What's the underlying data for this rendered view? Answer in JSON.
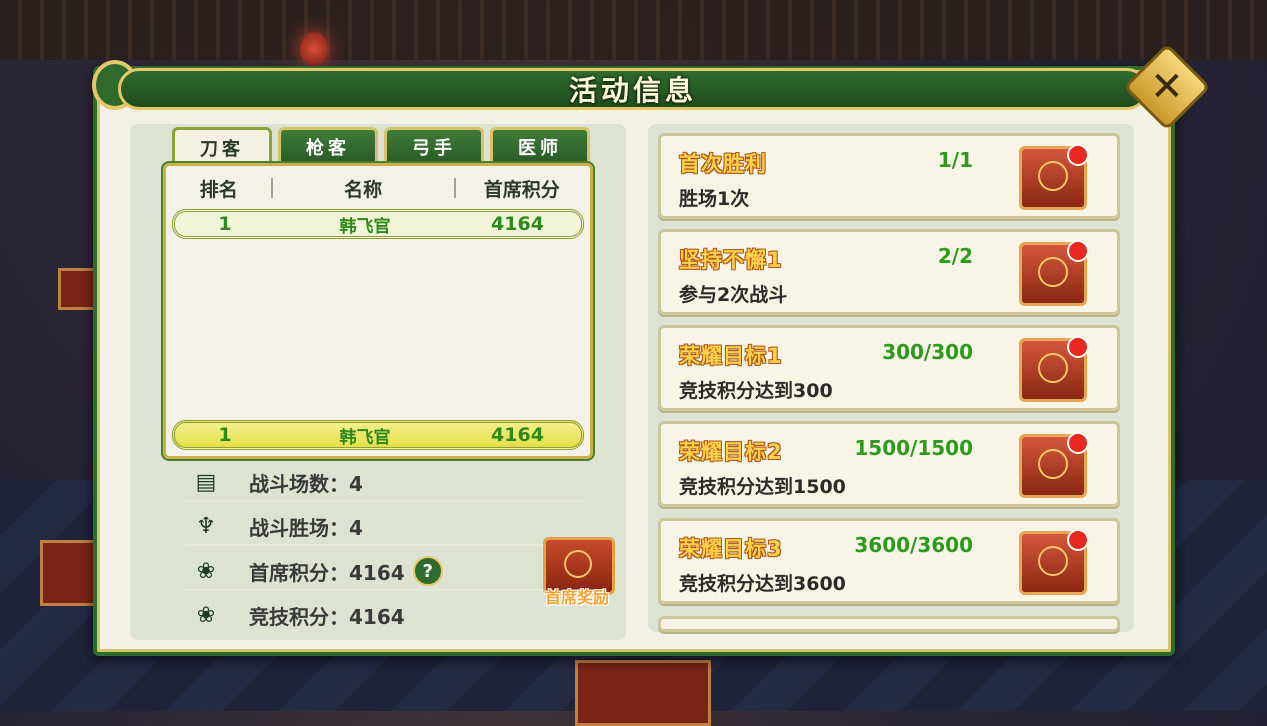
{
  "title": "活动信息",
  "tabs": [
    "刀客",
    "枪客",
    "弓手",
    "医师"
  ],
  "rank_table": {
    "headers": {
      "rank": "排名",
      "name": "名称",
      "score": "首席积分"
    },
    "top_row": {
      "rank": "1",
      "name": "韩飞官",
      "score": "4164"
    },
    "my_row": {
      "rank": "1",
      "name": "韩飞官",
      "score": "4164"
    }
  },
  "stats": [
    {
      "icon": "document-icon",
      "text": "战斗场数：4"
    },
    {
      "icon": "crown-icon",
      "text": "战斗胜场：4"
    },
    {
      "icon": "lotus-icon",
      "text": "首席积分：4164"
    },
    {
      "icon": "lotus-icon",
      "text": "竞技积分：4164"
    }
  ],
  "help_icon": "?",
  "reward": {
    "label": "首席奖励"
  },
  "tasks": [
    {
      "title": "首次胜利",
      "progress": "1/1",
      "desc": "胜场1次"
    },
    {
      "title": "坚持不懈1",
      "progress": "2/2",
      "desc": "参与2次战斗"
    },
    {
      "title": "荣耀目标1",
      "progress": "300/300",
      "desc": "竞技积分达到300"
    },
    {
      "title": "荣耀目标2",
      "progress": "1500/1500",
      "desc": "竞技积分达到1500"
    },
    {
      "title": "荣耀目标3",
      "progress": "3600/3600",
      "desc": "竞技积分达到3600"
    }
  ],
  "colors": {
    "frame_green": "#2f6b2c",
    "gold": "#e3c86a",
    "progress_green": "#2d9a1c",
    "title_orange": "#f29a24"
  }
}
